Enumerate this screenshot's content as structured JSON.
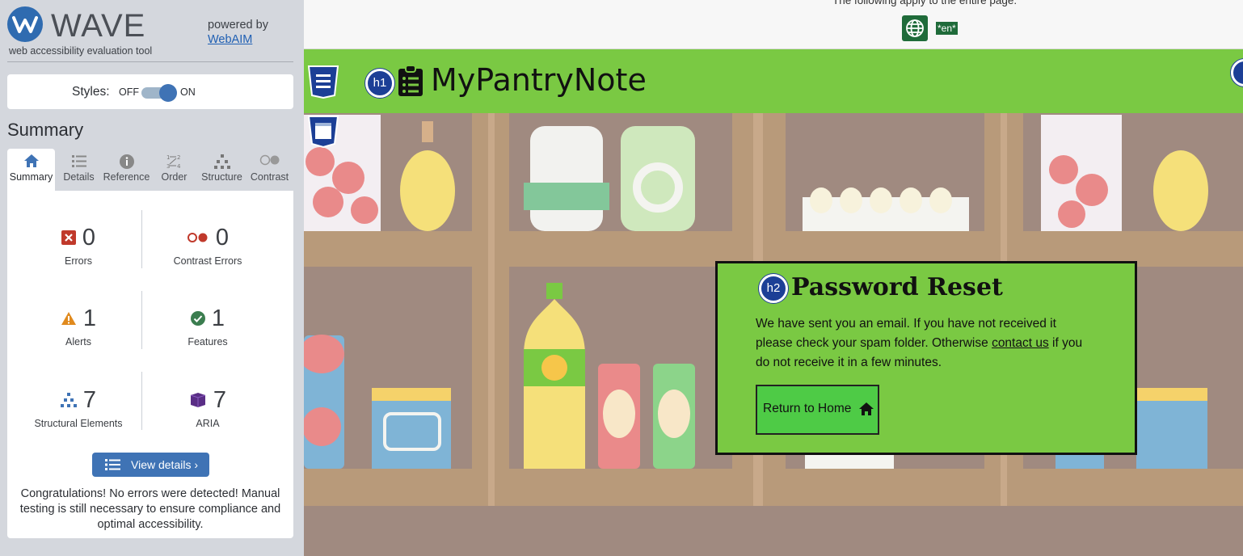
{
  "sidebar": {
    "logo_text": "WAVE",
    "tagline": "web accessibility evaluation tool",
    "powered_by": "powered by",
    "webaim_link": "WebAIM",
    "styles_label": "Styles:",
    "toggle_off": "OFF",
    "toggle_on": "ON",
    "styles_enabled": true,
    "summary_title": "Summary",
    "tabs": [
      {
        "label": "Summary",
        "icon": "home-icon",
        "active": true
      },
      {
        "label": "Details",
        "icon": "list-icon",
        "active": false
      },
      {
        "label": "Reference",
        "icon": "info-icon",
        "active": false
      },
      {
        "label": "Order",
        "icon": "order-icon",
        "active": false
      },
      {
        "label": "Structure",
        "icon": "structure-icon",
        "active": false
      },
      {
        "label": "Contrast",
        "icon": "contrast-icon",
        "active": false
      }
    ],
    "stats": {
      "errors": {
        "count": "0",
        "label": "Errors",
        "color": "#c0392b"
      },
      "contrast_errors": {
        "count": "0",
        "label": "Contrast Errors",
        "color": "#c0392b"
      },
      "alerts": {
        "count": "1",
        "label": "Alerts",
        "color": "#e08a1e"
      },
      "features": {
        "count": "1",
        "label": "Features",
        "color": "#3b7d4f"
      },
      "structural": {
        "count": "7",
        "label": "Structural Elements",
        "color": "#3f73b5"
      },
      "aria": {
        "count": "7",
        "label": "ARIA",
        "color": "#5a2e86"
      }
    },
    "view_details": "View details ›",
    "congrats": "Congratulations! No errors were detected! Manual testing is still necessary to ensure compliance and optimal accessibility."
  },
  "page": {
    "lang_note": "The following apply to the entire page:",
    "lang_badge": "*en*",
    "brand": "MyPantryNote",
    "h1_badge": "h1",
    "h2_badge": "h2",
    "reset_title": "Password Reset",
    "reset_text_1": "We have sent you an email. If you have not received it please check your spam folder. Otherwise ",
    "contact_link": "contact us",
    "reset_text_2": " if you do not receive it in a few minutes.",
    "home_button": "Return to Home",
    "nav_color": "#7ac943",
    "card_color": "#7ac943"
  }
}
